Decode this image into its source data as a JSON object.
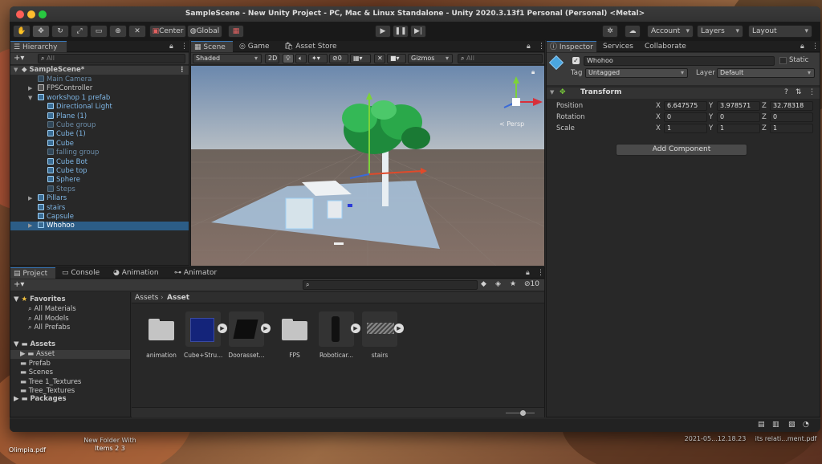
{
  "window": {
    "title": "SampleScene - New Unity Project - PC, Mac & Linux Standalone - Unity 2020.3.13f1 Personal (Personal) <Metal>"
  },
  "toolbar": {
    "center_label": "Center",
    "global_label": "Global",
    "account_label": "Account",
    "layers_label": "Layers",
    "layout_label": "Layout"
  },
  "hierarchy": {
    "tab": "Hierarchy",
    "search_placeholder": "All",
    "scene": "SampleScene*",
    "items": [
      {
        "label": "Main Camera",
        "style": "dim"
      },
      {
        "label": "FPSController",
        "style": "normal"
      },
      {
        "label": "workshop 1 prefab",
        "style": "blue"
      },
      {
        "label": "Directional Light",
        "style": "blue"
      },
      {
        "label": "Plane (1)",
        "style": "blue"
      },
      {
        "label": "Cube group",
        "style": "dim"
      },
      {
        "label": "Cube (1)",
        "style": "blue"
      },
      {
        "label": "Cube",
        "style": "blue"
      },
      {
        "label": "falling group",
        "style": "dim"
      },
      {
        "label": "Cube Bot",
        "style": "blue"
      },
      {
        "label": "Cube top",
        "style": "blue"
      },
      {
        "label": "Sphere",
        "style": "blue"
      },
      {
        "label": "Steps",
        "style": "dim"
      },
      {
        "label": "Pillars",
        "style": "blue"
      },
      {
        "label": "stairs",
        "style": "blue"
      },
      {
        "label": "Capsule",
        "style": "blue"
      },
      {
        "label": "Whohoo",
        "style": "selected"
      }
    ]
  },
  "scene_view": {
    "tabs": [
      "Scene",
      "Game",
      "Asset Store"
    ],
    "shading": "Shaded",
    "mode_2d": "2D",
    "hidden_count": "0",
    "gizmos": "Gizmos",
    "search_placeholder": "All",
    "persp_label": "< Persp"
  },
  "inspector": {
    "tabs": [
      "Inspector",
      "Services",
      "Collaborate"
    ],
    "object_name": "Whohoo",
    "static_label": "Static",
    "tag_label": "Tag",
    "tag_value": "Untagged",
    "layer_label": "Layer",
    "layer_value": "Default",
    "component_title": "Transform",
    "position_label": "Position",
    "rotation_label": "Rotation",
    "scale_label": "Scale",
    "position": {
      "x": "6.647575",
      "y": "3.978571",
      "z": "32.78318"
    },
    "rotation": {
      "x": "0",
      "y": "0",
      "z": "0"
    },
    "scale": {
      "x": "1",
      "y": "1",
      "z": "1"
    },
    "add_component": "Add Component"
  },
  "project": {
    "tabs": [
      "Project",
      "Console",
      "Animation",
      "Animator"
    ],
    "hidden_count": "10",
    "favorites_label": "Favorites",
    "favorites": [
      "All Materials",
      "All Models",
      "All Prefabs"
    ],
    "assets_label": "Assets",
    "asset_folders": [
      "Asset",
      "Prefab",
      "Scenes",
      "Tree 1_Textures",
      "Tree_Textures"
    ],
    "packages_label": "Packages",
    "breadcrumb_root": "Assets",
    "breadcrumb_current": "Asset",
    "items": [
      "animation",
      "Cube+Stru...",
      "Doorasset...",
      "FPS",
      "Roboticar...",
      "stairs"
    ]
  },
  "desktop": {
    "file1": "Olimpia.pdf",
    "file2_line1": "New Folder With",
    "file2_line2": "Items 2 3",
    "file3": "2021-05...12.18.23",
    "file4": "its relati...ment.pdf"
  },
  "colors": {
    "accent": "#3a79bb",
    "selection": "#2c5d87",
    "panel": "#282828"
  }
}
